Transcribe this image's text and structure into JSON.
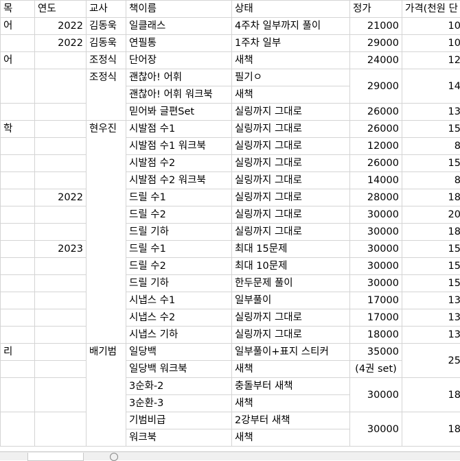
{
  "headers": {
    "col_a": "목",
    "year": "연도",
    "teacher": "교사",
    "book": "책이름",
    "status": "상태",
    "price": "정가",
    "sale": "가격(천원 단"
  },
  "rows": [
    {
      "a": "어",
      "year": "2022",
      "teacher": "김동욱",
      "book": "일클래스",
      "status": "4주차 일부까지 풀이",
      "price": "21000",
      "sale": "10"
    },
    {
      "a": "",
      "year": "2022",
      "teacher": "김동욱",
      "book": "연필통",
      "status": "1주차 일부",
      "price": "29000",
      "sale": "10"
    },
    {
      "a": "어",
      "year": "",
      "teacher": "조정식",
      "book": "단어장",
      "status": "새책",
      "price": "24000",
      "sale": "12"
    },
    {
      "a": "",
      "year": "",
      "teacher": "조정식",
      "book": "괜찮아! 어휘",
      "status": "필기ㅇ",
      "price": "29000",
      "sale": "14"
    },
    {
      "book": "괜찮아! 어휘 워크북",
      "status": "새책"
    },
    {
      "a": "",
      "year": "",
      "teacher": "",
      "book": "믿어봐 글편Set",
      "status": "실링까지 그대로",
      "price": "26000",
      "sale": "13"
    },
    {
      "a": "학",
      "year": "",
      "teacher": "현우진",
      "book": "시발점 수1",
      "status": "실링까지 그대로",
      "price": "26000",
      "sale": "15"
    },
    {
      "a": "",
      "year": "",
      "teacher": "",
      "book": "시발점 수1 워크북",
      "status": "실링까지 그대로",
      "price": "12000",
      "sale": "8"
    },
    {
      "a": "",
      "year": "",
      "teacher": "",
      "book": "시발점 수2",
      "status": "실링까지 그대로",
      "price": "26000",
      "sale": "15"
    },
    {
      "a": "",
      "year": "",
      "teacher": "",
      "book": "시발점 수2 워크북",
      "status": "실링까지 그대로",
      "price": "14000",
      "sale": "8"
    },
    {
      "a": "",
      "year": "2022",
      "teacher": "",
      "book": "드릴 수1",
      "status": "실링까지 그대로",
      "price": "28000",
      "sale": "18"
    },
    {
      "a": "",
      "year": "",
      "teacher": "",
      "book": "드릴 수2",
      "status": "실링까지 그대로",
      "price": "30000",
      "sale": "20"
    },
    {
      "a": "",
      "year": "",
      "teacher": "",
      "book": "드릴 기하",
      "status": "실링까지 그대로",
      "price": "30000",
      "sale": "18"
    },
    {
      "a": "",
      "year": "2023",
      "teacher": "",
      "book": "드릴 수1",
      "status": "최대 15문제",
      "price": "30000",
      "sale": "15"
    },
    {
      "a": "",
      "year": "",
      "teacher": "",
      "book": "드릴 수2",
      "status": "최대 10문제",
      "price": "30000",
      "sale": "15"
    },
    {
      "a": "",
      "year": "",
      "teacher": "",
      "book": "드릴 기하",
      "status": "한두문제 풀이",
      "price": "30000",
      "sale": "15"
    },
    {
      "a": "",
      "year": "",
      "teacher": "",
      "book": "시냅스 수1",
      "status": "일부풀이",
      "price": "17000",
      "sale": "13"
    },
    {
      "a": "",
      "year": "",
      "teacher": "",
      "book": "시냅스 수2",
      "status": "실링까지 그대로",
      "price": "17000",
      "sale": "13"
    },
    {
      "a": "",
      "year": "",
      "teacher": "",
      "book": "시냅스 기하",
      "status": "실링까지 그대로",
      "price": "18000",
      "sale": "13"
    },
    {
      "a": "리",
      "year": "",
      "teacher": "배기범",
      "book": "일당백",
      "status": "일부풀이+표지 스티커",
      "price": "35000",
      "price2": "(4권 set)",
      "sale": "25"
    },
    {
      "book": "일당백 워크북",
      "status": "새책"
    },
    {
      "a": "",
      "year": "",
      "teacher": "",
      "book": "3순화-2",
      "status": "충돌부터 새책",
      "price": "30000",
      "sale": "18"
    },
    {
      "book": "3순환-3",
      "status": "새책"
    },
    {
      "a": "",
      "year": "",
      "teacher": "",
      "book": "기범비급",
      "status": "2강부터 새책",
      "price": "30000",
      "sale": "18"
    },
    {
      "book": "워크북",
      "status": "새책"
    }
  ]
}
